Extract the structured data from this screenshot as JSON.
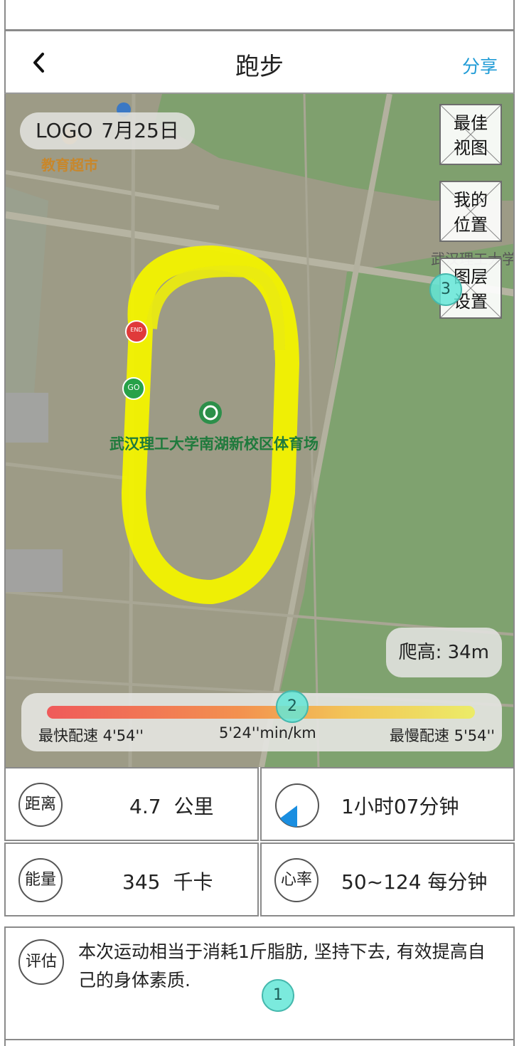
{
  "nav": {
    "title": "跑步",
    "share_label": "分享",
    "back_icon": "chevron-left-icon"
  },
  "map": {
    "logo": "LOGO",
    "date": "7月25日",
    "poi_supermarket": "教育超市",
    "poi_university": "武汉理工大学",
    "poi_stadium": "武汉理工大学南湖新校区体育场",
    "start_marker": "GO",
    "end_marker": "END",
    "buttons": {
      "best_view": [
        "最佳",
        "视图"
      ],
      "my_location": [
        "我的",
        "位置"
      ],
      "layer_settings": [
        "图层",
        "设置"
      ]
    },
    "climb": "爬高: 34m",
    "route_color": "#f3f300"
  },
  "pace": {
    "fastest": "最快配速 4'54''",
    "average": "5'24''min/km",
    "slowest": "最慢配速 5'54''",
    "gradient": [
      "#ef5a5a",
      "#f3914f",
      "#f2c457",
      "#ecec68"
    ]
  },
  "stats": {
    "distance": {
      "icon_label": "距离",
      "value": "4.7",
      "unit": "公里"
    },
    "duration": {
      "icon": "clock-icon",
      "value": "1小时07分钟"
    },
    "energy": {
      "icon_label": "能量",
      "value": "345",
      "unit": "千卡"
    },
    "heart_rate": {
      "icon_label": "心率",
      "value": "50~124 每分钟"
    }
  },
  "assessment": {
    "icon_label": "评估",
    "text": "本次运动相当于消耗1斤脂肪, 坚持下去, 有效提高自己的身体素质."
  },
  "annotations": [
    "1",
    "2",
    "3"
  ],
  "colors": {
    "accent": "#1f9bd6",
    "badge": "#64e6d7",
    "clock_fill": "#1a8ee0"
  }
}
